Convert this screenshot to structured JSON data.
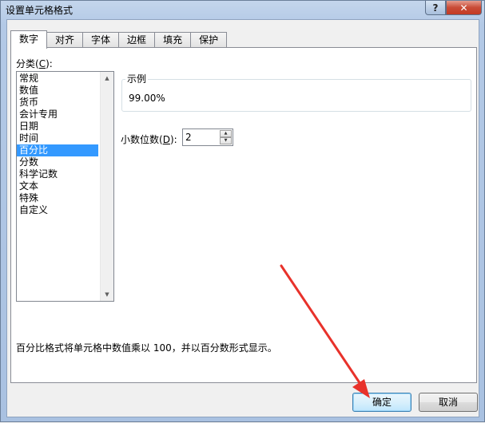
{
  "window": {
    "title": "设置单元格格式",
    "help_label": "?",
    "close_label": "✕"
  },
  "tabs": [
    {
      "label": "数字",
      "active": true
    },
    {
      "label": "对齐",
      "active": false
    },
    {
      "label": "字体",
      "active": false
    },
    {
      "label": "边框",
      "active": false
    },
    {
      "label": "填充",
      "active": false
    },
    {
      "label": "保护",
      "active": false
    }
  ],
  "category": {
    "label_prefix": "分类(",
    "label_key": "C",
    "label_suffix": "):",
    "items": [
      "常规",
      "数值",
      "货币",
      "会计专用",
      "日期",
      "时间",
      "百分比",
      "分数",
      "科学记数",
      "文本",
      "特殊",
      "自定义"
    ],
    "selected_index": 6
  },
  "sample": {
    "legend": "示例",
    "value": "99.00%"
  },
  "decimals": {
    "label_prefix": "小数位数(",
    "label_key": "D",
    "label_suffix": "):",
    "value": "2"
  },
  "description": "百分比格式将单元格中数值乘以 100，并以百分数形式显示。",
  "buttons": {
    "ok": "确定",
    "cancel": "取消"
  },
  "colors": {
    "selection": "#3399ff",
    "annotation_arrow": "#e8322b"
  }
}
